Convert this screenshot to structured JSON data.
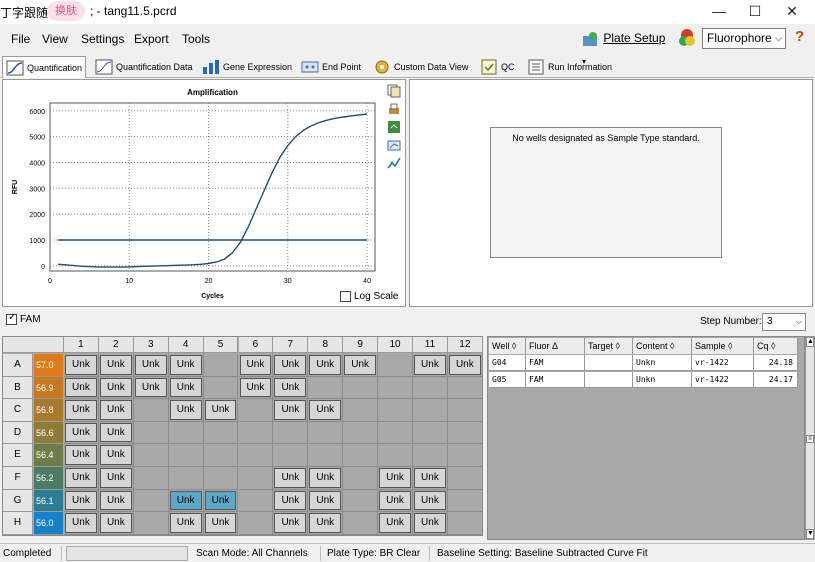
{
  "title": {
    "prefix": "丁字跟随",
    "badge": "换肤",
    "file": "; - tang11.5.pcrd",
    "min": "—",
    "max": "☐",
    "close": "✕"
  },
  "menu": {
    "file": "File",
    "view": "View",
    "settings": "Settings",
    "export": "Export",
    "tools": "Tools",
    "plate_setup": "Plate Setup",
    "fluorophore": "Fluorophore",
    "help": "?"
  },
  "tabs": [
    {
      "label": "Quantification",
      "icon": "amplification-icon"
    },
    {
      "label": "Quantification Data",
      "icon": "data-sheet-icon"
    },
    {
      "label": "Gene Expression",
      "icon": "bar-chart-icon"
    },
    {
      "label": "End Point",
      "icon": "endpoint-icon"
    },
    {
      "label": "Custom Data View",
      "icon": "custom-view-icon"
    },
    {
      "label": "QC",
      "icon": "qc-icon"
    },
    {
      "label": "Run Information",
      "icon": "info-icon"
    }
  ],
  "chart_data": {
    "type": "line",
    "title": "Amplification",
    "xlabel": "Cycles",
    "ylabel": "RFU",
    "xlim": [
      0,
      41
    ],
    "ylim": [
      -200,
      6300
    ],
    "xticks": [
      0,
      10,
      20,
      30,
      40
    ],
    "yticks": [
      0,
      1000,
      2000,
      3000,
      4000,
      5000,
      6000
    ],
    "grid": true,
    "series": [
      {
        "color": "#1f4e79",
        "x": [
          1,
          2,
          3,
          4,
          5,
          6,
          7,
          8,
          9,
          10,
          11,
          12,
          13,
          14,
          15,
          16,
          17,
          18,
          19,
          20,
          21,
          22,
          23,
          24,
          25,
          26,
          27,
          28,
          29,
          30,
          31,
          32,
          33,
          34,
          35,
          36,
          37,
          38,
          39,
          40
        ],
        "y": [
          60,
          40,
          10,
          -20,
          -30,
          -40,
          -50,
          -50,
          -50,
          -40,
          -30,
          -20,
          -10,
          0,
          10,
          20,
          30,
          40,
          60,
          90,
          150,
          260,
          500,
          900,
          1500,
          2200,
          2900,
          3600,
          4200,
          4650,
          5000,
          5250,
          5420,
          5550,
          5640,
          5710,
          5760,
          5800,
          5840,
          5880
        ]
      },
      {
        "color": "#1f4e79",
        "x": [
          1,
          40
        ],
        "y": [
          1000,
          1000
        ]
      }
    ]
  },
  "log_scale": "Log Scale",
  "std_message": "No wells designated as Sample Type standard.",
  "fam_label": "FAM",
  "step_label": "Step Number:",
  "step_value": "3",
  "plate": {
    "columns": [
      "1",
      "2",
      "3",
      "4",
      "5",
      "6",
      "7",
      "8",
      "9",
      "10",
      "11",
      "12"
    ],
    "rows": [
      {
        "label": "A",
        "temp": "57.0",
        "color": "#e07b1a",
        "wells": [
          "Unk",
          "Unk",
          "Unk",
          "Unk",
          "",
          "Unk",
          "Unk",
          "Unk",
          "Unk",
          "",
          "Unk",
          "Unk"
        ]
      },
      {
        "label": "B",
        "temp": "56.9",
        "color": "#c8781f",
        "wells": [
          "Unk",
          "Unk",
          "Unk",
          "Unk",
          "",
          "Unk",
          "Unk",
          "",
          "",
          "",
          "",
          ""
        ]
      },
      {
        "label": "C",
        "temp": "56.8",
        "color": "#a97a2c",
        "wells": [
          "Unk",
          "Unk",
          "",
          "Unk",
          "Unk",
          "",
          "Unk",
          "Unk",
          "",
          "",
          "",
          ""
        ]
      },
      {
        "label": "D",
        "temp": "56.6",
        "color": "#8c7c38",
        "wells": [
          "Unk",
          "Unk",
          "",
          "",
          "",
          "",
          "",
          "",
          "",
          "",
          "",
          ""
        ]
      },
      {
        "label": "E",
        "temp": "56.4",
        "color": "#6e7d48",
        "wells": [
          "Unk",
          "Unk",
          "",
          "",
          "",
          "",
          "",
          "",
          "",
          "",
          "",
          ""
        ]
      },
      {
        "label": "F",
        "temp": "56.2",
        "color": "#4c7c64",
        "wells": [
          "Unk",
          "Unk",
          "",
          "",
          "",
          "",
          "Unk",
          "Unk",
          "",
          "Unk",
          "Unk",
          ""
        ]
      },
      {
        "label": "G",
        "temp": "56.1",
        "color": "#2b7d94",
        "wells": [
          "Unk",
          "Unk",
          "",
          "Unk",
          "Unk",
          "",
          "Unk",
          "Unk",
          "",
          "Unk",
          "Unk",
          ""
        ],
        "selected": [
          3,
          4
        ]
      },
      {
        "label": "H",
        "temp": "56.0",
        "color": "#1581c8",
        "wells": [
          "Unk",
          "Unk",
          "",
          "Unk",
          "Unk",
          "",
          "Unk",
          "Unk",
          "",
          "Unk",
          "Unk",
          ""
        ]
      }
    ]
  },
  "well_table": {
    "headers": [
      "Well",
      "Fluor",
      "Target",
      "Content",
      "Sample",
      "Cq"
    ],
    "sort_glyphs": [
      "◊",
      "Δ",
      "◊",
      "◊",
      "◊",
      "◊"
    ],
    "rows": [
      [
        "G04",
        "FAM",
        "",
        "Unkn",
        "vr-1422",
        "24.18"
      ],
      [
        "G05",
        "FAM",
        "",
        "Unkn",
        "vr-1422",
        "24.17"
      ]
    ]
  },
  "status": {
    "state": "Completed",
    "scan_mode": "Scan Mode: All Channels",
    "plate_type": "Plate Type: BR Clear",
    "baseline": "Baseline Setting: Baseline Subtracted Curve Fit"
  }
}
